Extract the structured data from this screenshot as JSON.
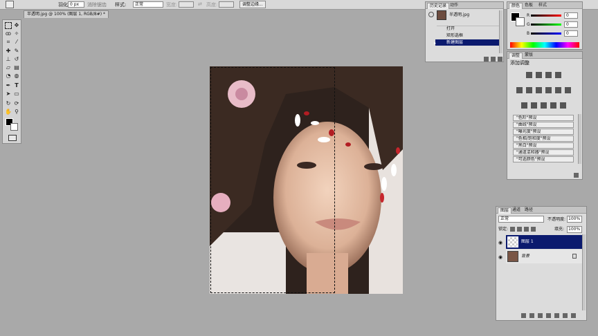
{
  "options_bar": {
    "feather_label": "羽化:",
    "feather_value": "0 px",
    "antialias_label": "消除锯齿",
    "style_label": "样式:",
    "style_value": "正常",
    "width_label": "宽度:",
    "height_label": "高度:",
    "refine_edge_button": "调整边缘..."
  },
  "document_tab": {
    "title": "半透明.jpg @ 100% (图层 1, RGB/8#) *"
  },
  "history_panel": {
    "tabs": [
      "历史记录",
      "动作"
    ],
    "snapshot_name": "半透明.jpg",
    "items": [
      "打开",
      "矩形选框",
      "新建图层"
    ]
  },
  "color_panel": {
    "tabs": [
      "颜色",
      "色板",
      "样式"
    ],
    "channels": [
      {
        "label": "R",
        "value": "0"
      },
      {
        "label": "G",
        "value": "0"
      },
      {
        "label": "B",
        "value": "0"
      }
    ]
  },
  "adjustments_panel": {
    "tabs": [
      "调整",
      "蒙版"
    ],
    "title": "添加调整",
    "presets": [
      "\"色阶\"预设",
      "\"曲线\"预设",
      "\"曝光度\"预设",
      "\"色相/饱和度\"预设",
      "\"黑白\"预设",
      "\"通道混和器\"预设",
      "\"可选颜色\"预设"
    ]
  },
  "layers_panel": {
    "tabs": [
      "图层",
      "通道",
      "路径"
    ],
    "blend_mode": "正常",
    "opacity_label": "不透明度:",
    "opacity_value": "100%",
    "lock_label": "锁定:",
    "fill_label": "填充:",
    "fill_value": "100%",
    "layers": [
      {
        "name": "图层 1",
        "selected": true
      },
      {
        "name": "背景",
        "selected": false
      }
    ]
  },
  "colors": {
    "selection_highlight": "#0b1a6e",
    "workspace": "#a9a9a9"
  }
}
